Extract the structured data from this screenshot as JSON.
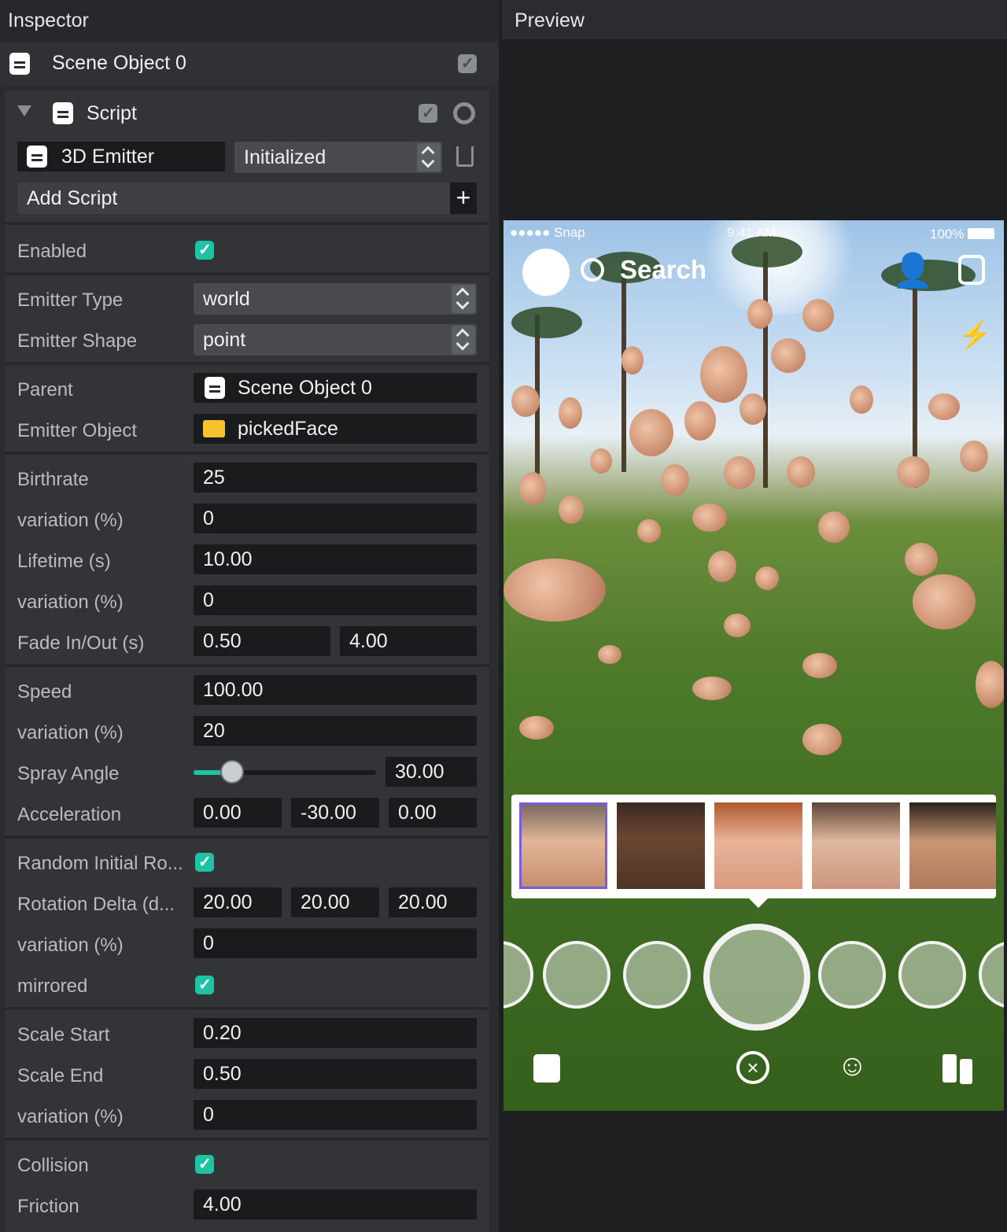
{
  "inspector": {
    "title": "Inspector",
    "object_name": "Scene Object 0",
    "component": "Script",
    "script_name": "3D Emitter",
    "script_event": "Initialized",
    "add_script": "Add Script",
    "fields": {
      "enabled": "Enabled",
      "emitter_type": {
        "label": "Emitter Type",
        "value": "world"
      },
      "emitter_shape": {
        "label": "Emitter Shape",
        "value": "point"
      },
      "parent": {
        "label": "Parent",
        "value": "Scene Object 0"
      },
      "emitter_object": {
        "label": "Emitter Object",
        "value": "pickedFace"
      },
      "birthrate": {
        "label": "Birthrate",
        "value": "25"
      },
      "birth_variation": {
        "label": "variation (%)",
        "value": "0"
      },
      "lifetime": {
        "label": "Lifetime (s)",
        "value": "10.00"
      },
      "life_variation": {
        "label": "variation (%)",
        "value": "0"
      },
      "fade": {
        "label": "Fade In/Out (s)",
        "in": "0.50",
        "out": "4.00"
      },
      "speed": {
        "label": "Speed",
        "value": "100.00"
      },
      "speed_variation": {
        "label": "variation (%)",
        "value": "20"
      },
      "spray_angle": {
        "label": "Spray Angle",
        "value": "30.00",
        "fraction": 0.21
      },
      "acceleration": {
        "label": "Acceleration",
        "x": "0.00",
        "y": "-30.00",
        "z": "0.00"
      },
      "random_rot": "Random Initial Ro...",
      "rot_delta": {
        "label": "Rotation Delta (d...",
        "x": "20.00",
        "y": "20.00",
        "z": "20.00"
      },
      "rot_variation": {
        "label": "variation (%)",
        "value": "0"
      },
      "mirrored": "mirrored",
      "scale_start": {
        "label": "Scale Start",
        "value": "0.20"
      },
      "scale_end": {
        "label": "Scale End",
        "value": "0.50"
      },
      "scale_variation": {
        "label": "variation (%)",
        "value": "0"
      },
      "collision": "Collision",
      "friction": {
        "label": "Friction",
        "value": "4.00"
      }
    }
  },
  "preview": {
    "title": "Preview",
    "status_carrier": "●●●●● Snap",
    "status_time": "9:41 AM",
    "status_battery": "100%",
    "search": "Search"
  },
  "colors": {
    "accent_green": "#1ec3a4",
    "selected_face": "#7b5cd6"
  }
}
